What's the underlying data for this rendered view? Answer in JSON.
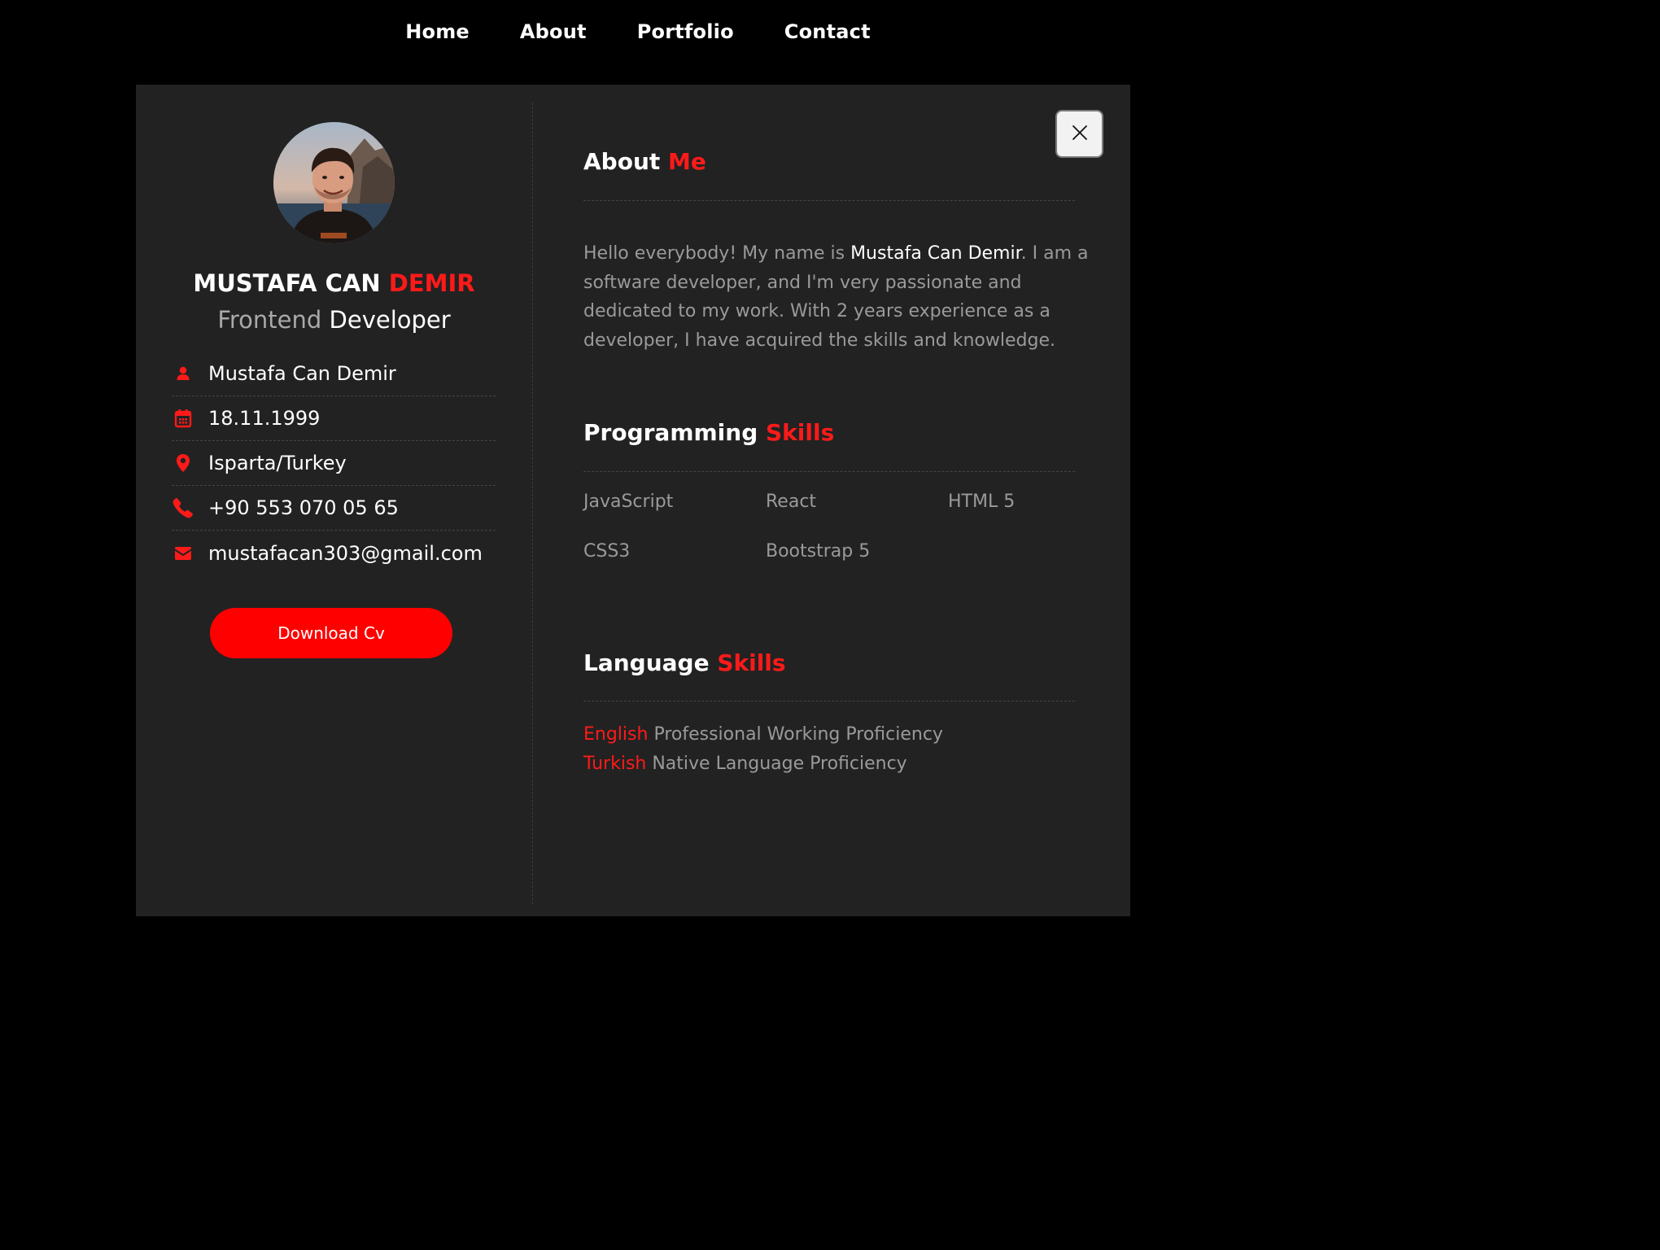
{
  "nav": {
    "items": [
      {
        "label": "Home"
      },
      {
        "label": "About"
      },
      {
        "label": "Portfolio"
      },
      {
        "label": "Contact"
      }
    ]
  },
  "profile": {
    "name_first": "MUSTAFA CAN",
    "name_last": "DEMIR",
    "role_prefix": "Frontend",
    "role_main": "Developer",
    "info": [
      {
        "icon": "user-icon",
        "text": "Mustafa Can Demir"
      },
      {
        "icon": "calendar-icon",
        "text": "18.11.1999"
      },
      {
        "icon": "location-pin-icon",
        "text": "Isparta/Turkey"
      },
      {
        "icon": "phone-icon",
        "text": "+90 553 070 05 65"
      },
      {
        "icon": "envelope-icon",
        "text": "mustafacan303@gmail.com"
      }
    ],
    "download_label": "Download Cv"
  },
  "about": {
    "title_white": "About",
    "title_red": "Me",
    "text_before": "Hello everybody! My name is ",
    "text_highlight": "Mustafa Can Demir",
    "text_after": ". I am a software developer, and I'm very passionate and dedicated to my work. With 2 years experience as a developer, I have acquired the skills and knowledge."
  },
  "programming": {
    "title_white": "Programming",
    "title_red": "Skills",
    "skills": [
      "JavaScript",
      "React",
      "HTML 5",
      "CSS3",
      "Bootstrap 5"
    ]
  },
  "languages": {
    "title_white": "Language",
    "title_red": "Skills",
    "items": [
      {
        "name": "English",
        "level": "Professional Working Proficiency"
      },
      {
        "name": "Turkish",
        "level": "Native Language Proficiency"
      }
    ]
  },
  "colors": {
    "accent": "#ff0000",
    "card_background": "#222222",
    "page_background": "#000000",
    "muted_text": "#9a9a9a"
  }
}
